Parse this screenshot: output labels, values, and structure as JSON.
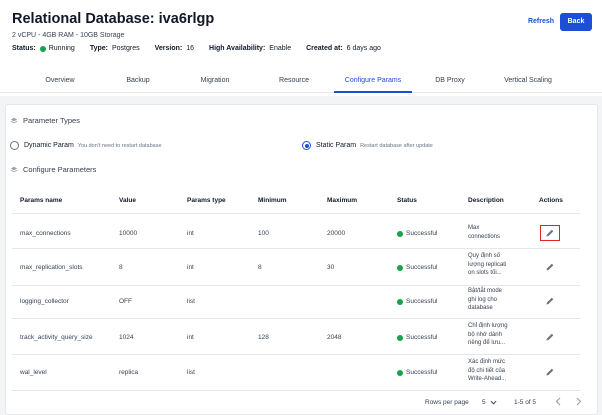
{
  "header": {
    "title": "Relational Database: iva6rlgp",
    "subtitle": "2 vCPU - 4GB RAM - 10GB Storage",
    "refresh_label": "Refresh",
    "back_label": "Back",
    "meta": [
      {
        "key": "Status:",
        "value": "Running"
      },
      {
        "key": "Type:",
        "value": "Postgres"
      },
      {
        "key": "Version:",
        "value": "16"
      },
      {
        "key": "High Availability:",
        "value": "Enable"
      },
      {
        "key": "Created at:",
        "value": "6 days ago"
      }
    ]
  },
  "tabs": [
    {
      "label": "Overview"
    },
    {
      "label": "Backup"
    },
    {
      "label": "Migration"
    },
    {
      "label": "Resource"
    },
    {
      "label": "Configure Params",
      "active": true
    },
    {
      "label": "DB Proxy"
    },
    {
      "label": "Vertical Scaling"
    }
  ],
  "param_types": {
    "heading": "Parameter Types",
    "dynamic": {
      "label": "Dynamic Param",
      "hint": "You don't need to restart database"
    },
    "static": {
      "label": "Static Param",
      "hint": "Restart database after update"
    }
  },
  "configure": {
    "heading": "Configure Parameters",
    "columns": [
      "Params name",
      "Value",
      "Params type",
      "Minimum",
      "Maximum",
      "Status",
      "Description",
      "Actions"
    ],
    "rows": [
      {
        "name": "max_connections",
        "value": "10000",
        "type": "int",
        "min": "100",
        "max": "20000",
        "status": "Successful",
        "description": [
          "Max",
          "connections"
        ]
      },
      {
        "name": "max_replication_slots",
        "value": "8",
        "type": "int",
        "min": "8",
        "max": "30",
        "status": "Successful",
        "description": [
          "Quy định số",
          "lượng replicati",
          "on slots tối..."
        ]
      },
      {
        "name": "logging_collector",
        "value": "OFF",
        "type": "list",
        "min": "",
        "max": "",
        "status": "Successful",
        "description": [
          "Bật/tắt mode",
          "ghi log cho",
          "database"
        ]
      },
      {
        "name": "track_activity_query_size",
        "value": "1024",
        "type": "int",
        "min": "128",
        "max": "2048",
        "status": "Successful",
        "description": [
          "Chỉ định lượng",
          "bộ nhớ dành",
          "riêng để lưu..."
        ]
      },
      {
        "name": "wal_level",
        "value": "replica",
        "type": "list",
        "min": "",
        "max": "",
        "status": "Successful",
        "description": [
          "Xác định mức",
          "độ chi tiết của",
          "Write-Ahead..."
        ]
      }
    ]
  },
  "pagination": {
    "rows_per_page_label": "Rows per page",
    "rows_per_page_value": "5",
    "range": "1-5 of 5"
  },
  "colors": {
    "accent": "#1d4ed8",
    "success": "#16a34a",
    "highlight": "#dc2626"
  }
}
